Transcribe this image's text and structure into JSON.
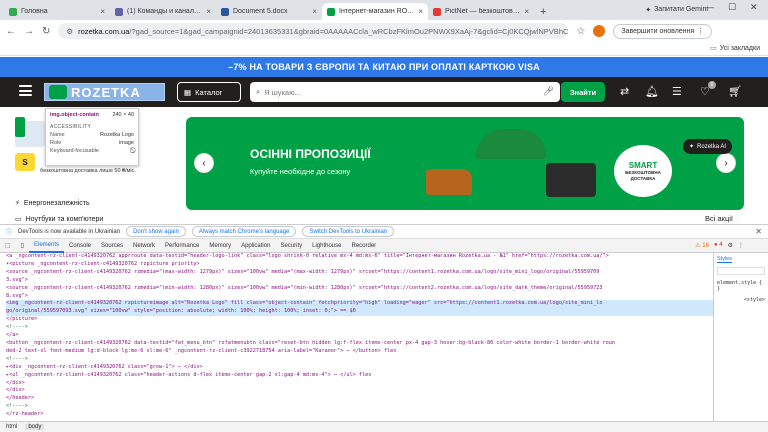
{
  "browser": {
    "tabs": [
      {
        "title": "Головна",
        "favicon_color": "#34a853",
        "active": false
      },
      {
        "title": "(1) Команды и каналы |",
        "favicon_color": "#6264a7",
        "active": false
      },
      {
        "title": "Document 5.docx",
        "favicon_color": "#2b579a",
        "active": false
      },
      {
        "title": "Інтернет-магазин ROZETKA",
        "favicon_color": "#00a046",
        "active": true
      },
      {
        "title": "PictNet — безкоштовний ;",
        "favicon_color": "#e53935",
        "active": false
      }
    ],
    "gemini_label": "Запитати Gemini",
    "url_host": "rozetka.com.ua",
    "url_rest": "/?gad_source=1&gad_campaignid=24013635331&gbraid=0AAAAACcla_wRCbzFKlmOu2PNWX9XaAj-7&gclid=Cj0KCQjwlNPVBhCMARIsAPZ5Rqgl",
    "update_label": "Завершити оновлення",
    "bookmarks_all": "Усі закладки"
  },
  "site": {
    "promo": "–7% НА ТОВАРИ З ЄВРОПИ ТА КИТАЮ ПРИ ОПЛАТІ КАРТКОЮ VISA",
    "logo_text": "ROZETKA",
    "catalog_label": "Каталог",
    "search_placeholder": "Я шукаю...",
    "find_label": "Знайти",
    "cart_count": "0",
    "banner_title": "ОСІННІ ПРОПОЗИЦІЇ",
    "banner_subtitle": "Купуйте необхідне до сезону",
    "smart_title": "SMART",
    "smart_line1": "БЕЗКОШТОВНА",
    "smart_line2": "ДОСТАВКА",
    "rozetka_ai": "Rozetka AI",
    "all_categories": "Всі акції",
    "left_items": [
      "S",
      "безкоштовна доставка лише 50 ₴/міс.",
      "Енергонезалежність",
      "Ноутбуки та комп'ютери"
    ]
  },
  "tooltip": {
    "selector": "img.object-contain",
    "size": "240 × 40",
    "heading": "ACCESSIBILITY",
    "rows": [
      {
        "k": "Name",
        "v": "Rozetka Logo"
      },
      {
        "k": "Role",
        "v": "image"
      },
      {
        "k": "Keyboard-focusable",
        "v": "⃠"
      }
    ]
  },
  "devtools": {
    "info": "DevTools is now available in Ukrainian",
    "btn_dont": "Don't show again",
    "btn_match": "Always match Chrome's language",
    "btn_switch": "Switch DevTools to Ukrainian",
    "tabs": [
      "Elements",
      "Console",
      "Sources",
      "Network",
      "Performance",
      "Memory",
      "Application",
      "Security",
      "Lighthouse",
      "Recorder"
    ],
    "warnings": "16",
    "errors": "4",
    "styles_tab": "Styles",
    "styles_lines": [
      "element.style {",
      "}",
      "<style>"
    ],
    "breadcrumbs": [
      "html",
      "body"
    ],
    "code_lines": [
      "<a _ngcontent-rz-client-c4149320762 apprroute data-testid=\"header-logo-link\" class=\"logo shrink-0 relative mx-4 md:mx-6\" title=\"Інтернет-магазин Rozetka.ua - №1\" href=\"https://rozetka.com.ua/\">",
      "  ▾<picture _ngcontent-rz-client-c4149320762 rzpicture priority>",
      "      <source _ngcontent-rz-client-c4149320762 rzmedia=\"(max-width: 1279px)\" sizes=\"100vw\" media=\"(max-width: 1279px)\" srcset=\"https://content1.rozetka.com.ua/logo/site_mini_logo/original/55959709",
      "      3.svg\">",
      "      <source _ngcontent-rz-client-c4149320762 rzmedia=\"(min-width: 1280px)\" sizes=\"100vw\" media=\"(min-width: 1280px)\" srcset=\"https://content2.rozetka.com.ua/logo/site_dark_theme/original/55959723",
      "      8.svg\">",
      "      <img _ngcontent-rz-client-c4149320762 rzpictureimage alt=\"Rozetka Logo\" fill class=\"object-contain\" fetchpriority=\"high\" loading=\"eager\" src=\"https://content1.rozetka.com.ua/logo/site_mini_lo",
      "      go/original/559597093.svg\" sizes=\"100vw\" style=\"position: absolute; width: 100%; height: 100%; inset: 0;\"> == $0",
      "    </picture>",
      "    <!---->",
      "  </a>",
      "  <button _ngcontent-rz-client-c4149320762 data-testid=\"fat_menu_btn\" rzfatmenubtn class=\"reset-btn hidden lg:f-flex items-center px-4 gap-3 hover:bg-black-80 color-white border-1 border-white roun",
      "  ded-2 text-xl font-medium lg:d-block lg:me-6 xl:me-6\" _ngcontent-rz-client-c3922718754 aria-label=\"Каталог\"> ⋯ </button> flex",
      "  <!---->",
      "  ▸<div _ngcontent-rz-client-c4149320762 class=\"grow-1\"> ⋯ </div>",
      "  ▸<ul _ngcontent-rz-client-c4149320762 class=\"header-actions d-flex items-center gap-2 xl:gap-4 md:ms-4\"> ⋯ </ul> flex",
      "  </div>",
      "  </div>",
      "  </header>",
      "  <!---->",
      "  </rz-header>"
    ]
  }
}
